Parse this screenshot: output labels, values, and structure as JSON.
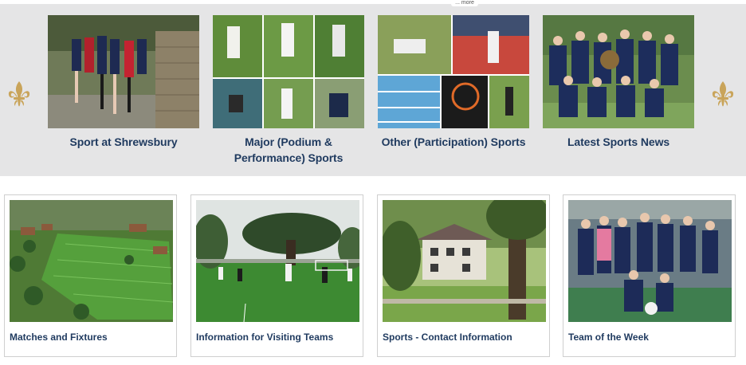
{
  "header": {
    "more_label": "... more"
  },
  "features": [
    {
      "caption": "Sport at Shrewsbury"
    },
    {
      "caption": "Major (Podium & Performance) Sports"
    },
    {
      "caption": "Other (Participation) Sports"
    },
    {
      "caption": "Latest Sports News"
    }
  ],
  "cards": [
    {
      "caption": "Matches and Fixtures"
    },
    {
      "caption": "Information for Visiting Teams"
    },
    {
      "caption": "Sports - Contact Information"
    },
    {
      "caption": "Team of the Week"
    }
  ],
  "colors": {
    "band_background": "#e5e5e6",
    "caption_text": "#1f3a5f",
    "fleur_gold": "#c9a45a"
  },
  "icons": {
    "left": "fleur-de-lis-icon",
    "right": "fleur-de-lis-icon"
  }
}
